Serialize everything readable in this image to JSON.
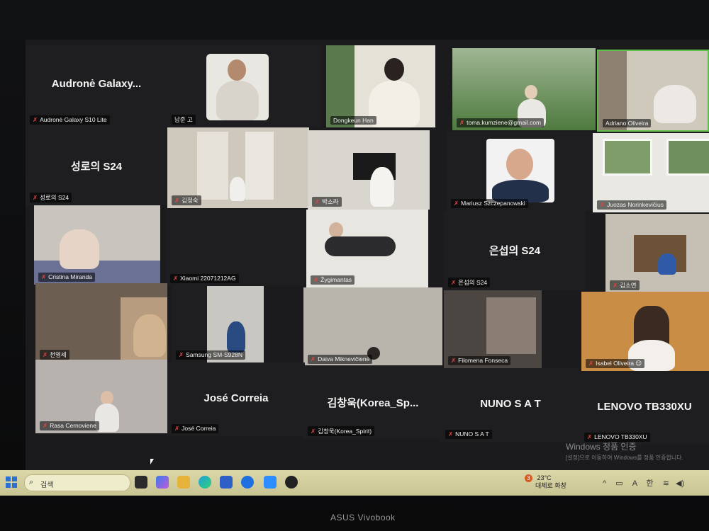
{
  "tiles": [
    {
      "name": "Audronė Galaxy S10 Lite",
      "big": "Audronė  Galaxy..."
    },
    {
      "name": "남준 고"
    },
    {
      "name": "Dongkeun Han"
    },
    {
      "name": "toma.kumziene@gmail.com"
    },
    {
      "name": "Adriano Oliveira"
    },
    {
      "name": "성로의 S24",
      "big": "성로의 S24"
    },
    {
      "name": "김정숙"
    },
    {
      "name": "박소라"
    },
    {
      "name": "Mariusz Szczepanowski"
    },
    {
      "name": "Juozas Norinkevičius"
    },
    {
      "name": "Cristina Miranda"
    },
    {
      "name": "Xiaomi 22071212AG"
    },
    {
      "name": "Žygimantas"
    },
    {
      "name": "은섭의 S24",
      "big": "은섭의 S24"
    },
    {
      "name": "김소연"
    },
    {
      "name": "천영세"
    },
    {
      "name": "Samsung SM-S928N"
    },
    {
      "name": "Daiva Miknevičienė"
    },
    {
      "name": "Filomena Fonseca"
    },
    {
      "name": "Isabel Oliveira 😊"
    },
    {
      "name": "Rasa Cernoviene"
    },
    {
      "name": "José Correia",
      "big": "José Correia"
    },
    {
      "name": "김창욱(Korea_Spirit)",
      "big": "김창욱(Korea_Sp..."
    },
    {
      "name": "NUNO S A T",
      "big": "NUNO S A T"
    },
    {
      "name": "LENOVO TB330XU",
      "big": "LENOVO TB330XU"
    }
  ],
  "watermark": {
    "title": "Windows 정품 인증",
    "sub": "[설정]으로 이동하여 Windows를 정품 인증합니다."
  },
  "taskbar": {
    "search_label": "검색",
    "weather_temp": "23°C",
    "weather_desc": "대체로 화창",
    "weather_badge": "3",
    "lang_a": "A",
    "lang_han": "한"
  },
  "laptop_brand": "ASUS Vivobook"
}
